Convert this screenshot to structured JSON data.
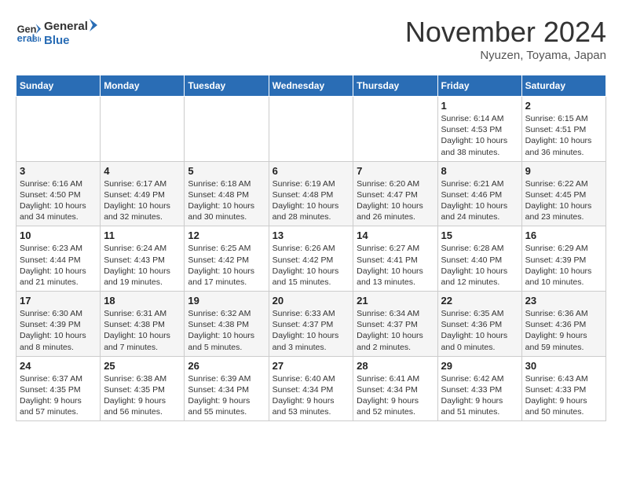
{
  "header": {
    "logo_line1": "General",
    "logo_line2": "Blue",
    "month_title": "November 2024",
    "location": "Nyuzen, Toyama, Japan"
  },
  "weekdays": [
    "Sunday",
    "Monday",
    "Tuesday",
    "Wednesday",
    "Thursday",
    "Friday",
    "Saturday"
  ],
  "weeks": [
    [
      {
        "day": "",
        "info": ""
      },
      {
        "day": "",
        "info": ""
      },
      {
        "day": "",
        "info": ""
      },
      {
        "day": "",
        "info": ""
      },
      {
        "day": "",
        "info": ""
      },
      {
        "day": "1",
        "info": "Sunrise: 6:14 AM\nSunset: 4:53 PM\nDaylight: 10 hours\nand 38 minutes."
      },
      {
        "day": "2",
        "info": "Sunrise: 6:15 AM\nSunset: 4:51 PM\nDaylight: 10 hours\nand 36 minutes."
      }
    ],
    [
      {
        "day": "3",
        "info": "Sunrise: 6:16 AM\nSunset: 4:50 PM\nDaylight: 10 hours\nand 34 minutes."
      },
      {
        "day": "4",
        "info": "Sunrise: 6:17 AM\nSunset: 4:49 PM\nDaylight: 10 hours\nand 32 minutes."
      },
      {
        "day": "5",
        "info": "Sunrise: 6:18 AM\nSunset: 4:48 PM\nDaylight: 10 hours\nand 30 minutes."
      },
      {
        "day": "6",
        "info": "Sunrise: 6:19 AM\nSunset: 4:48 PM\nDaylight: 10 hours\nand 28 minutes."
      },
      {
        "day": "7",
        "info": "Sunrise: 6:20 AM\nSunset: 4:47 PM\nDaylight: 10 hours\nand 26 minutes."
      },
      {
        "day": "8",
        "info": "Sunrise: 6:21 AM\nSunset: 4:46 PM\nDaylight: 10 hours\nand 24 minutes."
      },
      {
        "day": "9",
        "info": "Sunrise: 6:22 AM\nSunset: 4:45 PM\nDaylight: 10 hours\nand 23 minutes."
      }
    ],
    [
      {
        "day": "10",
        "info": "Sunrise: 6:23 AM\nSunset: 4:44 PM\nDaylight: 10 hours\nand 21 minutes."
      },
      {
        "day": "11",
        "info": "Sunrise: 6:24 AM\nSunset: 4:43 PM\nDaylight: 10 hours\nand 19 minutes."
      },
      {
        "day": "12",
        "info": "Sunrise: 6:25 AM\nSunset: 4:42 PM\nDaylight: 10 hours\nand 17 minutes."
      },
      {
        "day": "13",
        "info": "Sunrise: 6:26 AM\nSunset: 4:42 PM\nDaylight: 10 hours\nand 15 minutes."
      },
      {
        "day": "14",
        "info": "Sunrise: 6:27 AM\nSunset: 4:41 PM\nDaylight: 10 hours\nand 13 minutes."
      },
      {
        "day": "15",
        "info": "Sunrise: 6:28 AM\nSunset: 4:40 PM\nDaylight: 10 hours\nand 12 minutes."
      },
      {
        "day": "16",
        "info": "Sunrise: 6:29 AM\nSunset: 4:39 PM\nDaylight: 10 hours\nand 10 minutes."
      }
    ],
    [
      {
        "day": "17",
        "info": "Sunrise: 6:30 AM\nSunset: 4:39 PM\nDaylight: 10 hours\nand 8 minutes."
      },
      {
        "day": "18",
        "info": "Sunrise: 6:31 AM\nSunset: 4:38 PM\nDaylight: 10 hours\nand 7 minutes."
      },
      {
        "day": "19",
        "info": "Sunrise: 6:32 AM\nSunset: 4:38 PM\nDaylight: 10 hours\nand 5 minutes."
      },
      {
        "day": "20",
        "info": "Sunrise: 6:33 AM\nSunset: 4:37 PM\nDaylight: 10 hours\nand 3 minutes."
      },
      {
        "day": "21",
        "info": "Sunrise: 6:34 AM\nSunset: 4:37 PM\nDaylight: 10 hours\nand 2 minutes."
      },
      {
        "day": "22",
        "info": "Sunrise: 6:35 AM\nSunset: 4:36 PM\nDaylight: 10 hours\nand 0 minutes."
      },
      {
        "day": "23",
        "info": "Sunrise: 6:36 AM\nSunset: 4:36 PM\nDaylight: 9 hours\nand 59 minutes."
      }
    ],
    [
      {
        "day": "24",
        "info": "Sunrise: 6:37 AM\nSunset: 4:35 PM\nDaylight: 9 hours\nand 57 minutes."
      },
      {
        "day": "25",
        "info": "Sunrise: 6:38 AM\nSunset: 4:35 PM\nDaylight: 9 hours\nand 56 minutes."
      },
      {
        "day": "26",
        "info": "Sunrise: 6:39 AM\nSunset: 4:34 PM\nDaylight: 9 hours\nand 55 minutes."
      },
      {
        "day": "27",
        "info": "Sunrise: 6:40 AM\nSunset: 4:34 PM\nDaylight: 9 hours\nand 53 minutes."
      },
      {
        "day": "28",
        "info": "Sunrise: 6:41 AM\nSunset: 4:34 PM\nDaylight: 9 hours\nand 52 minutes."
      },
      {
        "day": "29",
        "info": "Sunrise: 6:42 AM\nSunset: 4:33 PM\nDaylight: 9 hours\nand 51 minutes."
      },
      {
        "day": "30",
        "info": "Sunrise: 6:43 AM\nSunset: 4:33 PM\nDaylight: 9 hours\nand 50 minutes."
      }
    ]
  ]
}
